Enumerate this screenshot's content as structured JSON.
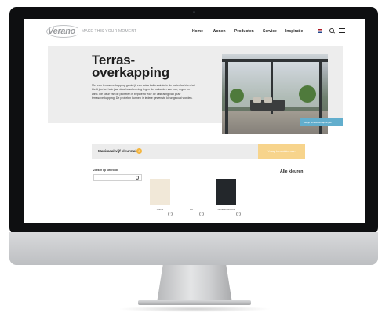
{
  "site": {
    "logo": "Verano",
    "tagline": "MAKE THIS YOUR MOMENT"
  },
  "nav": {
    "items": [
      "Home",
      "Wonen",
      "Producten",
      "Service",
      "Inspiratie"
    ]
  },
  "hero": {
    "title_line1": "Terras-",
    "title_line2": "overkapping",
    "text": "Met een terrasoverkapping geniet jij van extra buitenruimte in de buitenlucht en het biedt jou het hele jaar door bescherming tegen de invloeden van zon, regen en wind. De kleur van de profielen is bepalend voor de uitstraling van jouw terrasoverkapping. De profielen kunnen in iedere gewenste kleur gecoat worden.",
    "photo_badge": "Bekijk terrasoverkappingen"
  },
  "selection": {
    "label": "Maximaal vijf kleurstalen",
    "count": "0",
    "button": "Vraag kleurstalen aan"
  },
  "filter": {
    "label": "Zoeken op kleurcode",
    "all_colors": "Alle kleuren"
  },
  "swatches": [
    {
      "name": "Creme",
      "color": "#f1e8d8"
    },
    {
      "name": "Wit",
      "color": "#ffffff"
    },
    {
      "name": "Antraciet structuur",
      "color": "#23272b"
    }
  ],
  "colors": {
    "accent_yellow": "#f4b640",
    "accent_blue": "#62aecd",
    "hero_bg": "#ededed"
  }
}
